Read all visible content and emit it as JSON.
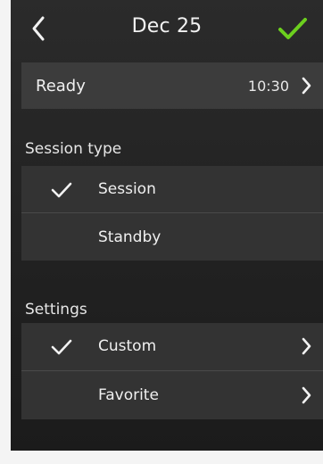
{
  "header": {
    "title": "Dec 25",
    "back_icon": "chevron-left-icon",
    "confirm_icon": "check-icon",
    "confirm_color": "#6ccf1e"
  },
  "ready_row": {
    "label": "Ready",
    "value": "10:30"
  },
  "session_type": {
    "title": "Session type",
    "items": [
      {
        "label": "Session",
        "selected": true
      },
      {
        "label": "Standby",
        "selected": false
      }
    ]
  },
  "settings": {
    "title": "Settings",
    "items": [
      {
        "label": "Custom",
        "selected": true
      },
      {
        "label": "Favorite",
        "selected": false
      }
    ]
  }
}
